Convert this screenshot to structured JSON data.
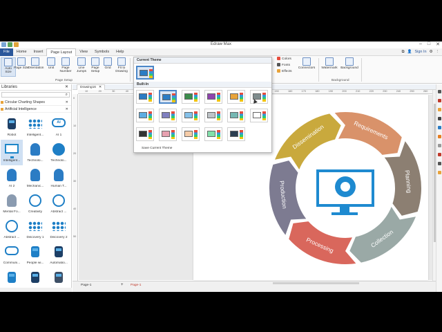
{
  "app": {
    "title": "Edraw Max",
    "sign_in": "Sign In"
  },
  "menu": [
    "File",
    "Home",
    "Insert",
    "Page Layout",
    "View",
    "Symbols",
    "Help"
  ],
  "ribbon": {
    "buttons": [
      "Auto Size",
      "Page Size",
      "Orientation",
      "Unit",
      "Page Number",
      "Line Jumps",
      "Page Setup",
      "Grid",
      "Fit to Drawing"
    ],
    "group_page_setup": "Page Setup",
    "theme_small": [
      "Colors",
      "Fonts",
      "Effects"
    ],
    "connectors": "Connectors",
    "watermark": "Watermark",
    "background": "Background",
    "group_background": "Background"
  },
  "libraries": {
    "title": "Libraries",
    "categories": [
      "Circular Charting Shapes",
      "Artificial Intelligence"
    ],
    "items": [
      "Robot",
      "Intelligent...",
      "AI 1",
      "Intelligent...",
      "Technolo...",
      "Technolo...",
      "AI 2",
      "Mechanic...",
      "Human T...",
      "Mental Fo...",
      "Creativity",
      "Abstract ...",
      "Abstract ...",
      "Discovery 1",
      "Discovery 2",
      "Communi...",
      "People wi...",
      "Automatio...",
      "",
      "",
      ""
    ]
  },
  "document": {
    "tab": "Drawing16",
    "page_tab": "Page-1",
    "page_tab_active": "Page-1"
  },
  "ruler": {
    "h": [
      "10",
      "20",
      "30",
      "40",
      "50",
      "60",
      "70",
      "80",
      "90",
      "100",
      "110",
      "120",
      "130",
      "140",
      "150",
      "160",
      "170",
      "180",
      "190",
      "200",
      "210",
      "220",
      "230",
      "240",
      "250",
      "260"
    ]
  },
  "theme_panel": {
    "current": "Current Theme",
    "builtin": "Built-In",
    "save": "Save Current Theme"
  },
  "diagram": {
    "segments": [
      "Requirements",
      "Planning",
      "Collection",
      "Processing",
      "Production",
      "Dissemination"
    ],
    "colors": [
      "#d9926a",
      "#8c7f72",
      "#9aa9a6",
      "#d9675c",
      "#7d7b91",
      "#c9a93d"
    ]
  }
}
